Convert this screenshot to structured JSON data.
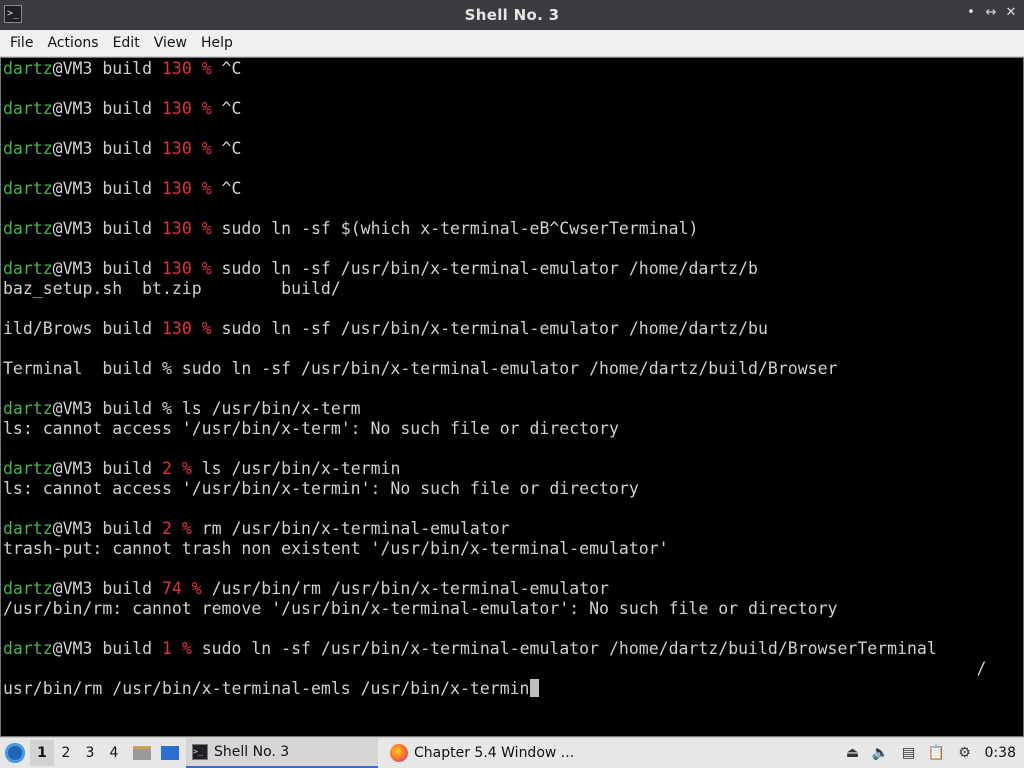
{
  "window": {
    "title": "Shell No. 3",
    "controls": {
      "minimize": "•",
      "restore": "↔",
      "close": "✕"
    }
  },
  "menubar": {
    "items": [
      "File",
      "Actions",
      "Edit",
      "View",
      "Help"
    ]
  },
  "terminal": {
    "colors": {
      "user": "#4fb14f",
      "code": "#e0323a",
      "text": "#d0d0d0",
      "background": "#000000"
    },
    "lines": [
      [
        {
          "t": "dartz",
          "c": "user"
        },
        {
          "t": "@VM3 build ",
          "c": "host"
        },
        {
          "t": "130 %",
          "c": "code"
        },
        {
          "t": " ^C",
          "c": "plain"
        }
      ],
      [],
      [
        {
          "t": "dartz",
          "c": "user"
        },
        {
          "t": "@VM3 build ",
          "c": "host"
        },
        {
          "t": "130 %",
          "c": "code"
        },
        {
          "t": " ^C",
          "c": "plain"
        }
      ],
      [],
      [
        {
          "t": "dartz",
          "c": "user"
        },
        {
          "t": "@VM3 build ",
          "c": "host"
        },
        {
          "t": "130 %",
          "c": "code"
        },
        {
          "t": " ^C",
          "c": "plain"
        }
      ],
      [],
      [
        {
          "t": "dartz",
          "c": "user"
        },
        {
          "t": "@VM3 build ",
          "c": "host"
        },
        {
          "t": "130 %",
          "c": "code"
        },
        {
          "t": " ^C",
          "c": "plain"
        }
      ],
      [],
      [
        {
          "t": "dartz",
          "c": "user"
        },
        {
          "t": "@VM3 build ",
          "c": "host"
        },
        {
          "t": "130 %",
          "c": "code"
        },
        {
          "t": " sudo ln -sf $(which x-terminal-eB^CwserTerminal)",
          "c": "plain"
        }
      ],
      [],
      [
        {
          "t": "dartz",
          "c": "user"
        },
        {
          "t": "@VM3 build ",
          "c": "host"
        },
        {
          "t": "130 %",
          "c": "code"
        },
        {
          "t": " sudo ln -sf /usr/bin/x-terminal-emulator /home/dartz/b",
          "c": "plain"
        }
      ],
      [
        {
          "t": "baz_setup.sh  bt.zip        build/",
          "c": "plain"
        }
      ],
      [],
      [
        {
          "t": "ild/Brows build ",
          "c": "plain"
        },
        {
          "t": "130 %",
          "c": "code"
        },
        {
          "t": " sudo ln -sf /usr/bin/x-terminal-emulator /home/dartz/bu",
          "c": "plain"
        }
      ],
      [],
      [
        {
          "t": "Terminal  build % sudo ln -sf /usr/bin/x-terminal-emulator /home/dartz/build/Browser",
          "c": "plain"
        }
      ],
      [],
      [
        {
          "t": "dartz",
          "c": "user"
        },
        {
          "t": "@VM3 build % ls /usr/bin/x-term",
          "c": "host"
        }
      ],
      [
        {
          "t": "ls: cannot access '/usr/bin/x-term': No such file or directory",
          "c": "plain"
        }
      ],
      [],
      [
        {
          "t": "dartz",
          "c": "user"
        },
        {
          "t": "@VM3 build ",
          "c": "host"
        },
        {
          "t": "2 %",
          "c": "code"
        },
        {
          "t": " ls /usr/bin/x-termin",
          "c": "plain"
        }
      ],
      [
        {
          "t": "ls: cannot access '/usr/bin/x-termin': No such file or directory",
          "c": "plain"
        }
      ],
      [],
      [
        {
          "t": "dartz",
          "c": "user"
        },
        {
          "t": "@VM3 build ",
          "c": "host"
        },
        {
          "t": "2 %",
          "c": "code"
        },
        {
          "t": " rm /usr/bin/x-terminal-emulator",
          "c": "plain"
        }
      ],
      [
        {
          "t": "trash-put: cannot trash non existent '/usr/bin/x-terminal-emulator'",
          "c": "plain"
        }
      ],
      [],
      [
        {
          "t": "dartz",
          "c": "user"
        },
        {
          "t": "@VM3 build ",
          "c": "host"
        },
        {
          "t": "74 %",
          "c": "code"
        },
        {
          "t": " /usr/bin/rm /usr/bin/x-terminal-emulator",
          "c": "plain"
        }
      ],
      [
        {
          "t": "/usr/bin/rm: cannot remove '/usr/bin/x-terminal-emulator': No such file or directory",
          "c": "plain"
        }
      ],
      [],
      [
        {
          "t": "dartz",
          "c": "user"
        },
        {
          "t": "@VM3 build ",
          "c": "host"
        },
        {
          "t": "1 %",
          "c": "code"
        },
        {
          "t": " sudo ln -sf /usr/bin/x-terminal-emulator /home/dartz/build/BrowserTerminal",
          "c": "plain"
        }
      ],
      [
        {
          "t": "                                                                                                  /",
          "c": "plain"
        }
      ],
      [
        {
          "t": "usr/bin/rm /usr/bin/x-terminal-emls /usr/bin/x-termin",
          "c": "plain"
        }
      ]
    ]
  },
  "taskbar": {
    "workspaces": [
      "1",
      "2",
      "3",
      "4"
    ],
    "active_workspace": "1",
    "quick_launch": [
      "file-manager-icon",
      "show-desktop-icon"
    ],
    "tasks": [
      {
        "label": "Shell No. 3",
        "icon": "terminal-icon",
        "active": true
      },
      {
        "label": "Chapter 5.4 Window ...",
        "icon": "firefox-icon",
        "active": false
      }
    ],
    "tray": [
      "eject-icon",
      "volume-icon",
      "network-icon",
      "clipboard-icon",
      "notification-icon"
    ],
    "clock": "0:38"
  }
}
